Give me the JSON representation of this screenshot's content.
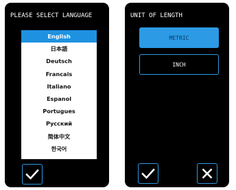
{
  "language_panel": {
    "heading": "PLEASE SELECT LANGUAGE",
    "selected": "English",
    "languages": [
      "English",
      "日本語",
      "Deutsch",
      "Francais",
      "Italiano",
      "Espanol",
      "Portugues",
      "Русский",
      "简体中文",
      "한국어"
    ]
  },
  "unit_panel": {
    "heading": "UNIT OF LENGTH",
    "options": [
      "METRIC",
      "INCH"
    ],
    "selected": "METRIC"
  },
  "icons": {
    "confirm": "check-icon",
    "cancel": "close-icon"
  },
  "colors": {
    "accent": "#2c9ae4",
    "selected_row": "#1e92e0",
    "panel_background": "#000000"
  }
}
